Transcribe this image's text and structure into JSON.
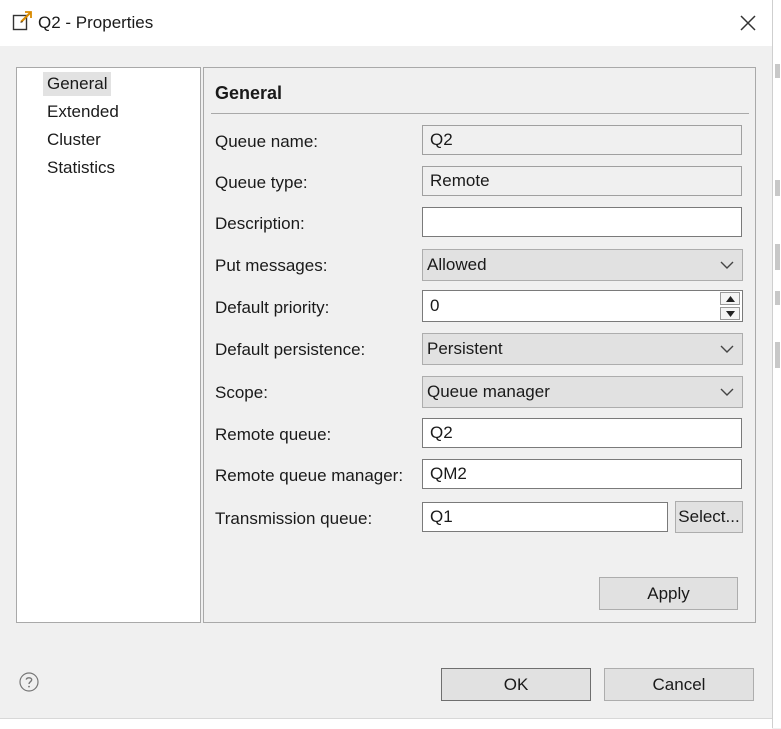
{
  "window": {
    "title": "Q2 - Properties"
  },
  "nav": {
    "items": [
      {
        "label": "General",
        "selected": true
      },
      {
        "label": "Extended",
        "selected": false
      },
      {
        "label": "Cluster",
        "selected": false
      },
      {
        "label": "Statistics",
        "selected": false
      }
    ]
  },
  "panel": {
    "heading": "General",
    "queue_name": {
      "label": "Queue name:",
      "value": "Q2"
    },
    "queue_type": {
      "label": "Queue type:",
      "value": "Remote"
    },
    "description": {
      "label": "Description:",
      "value": ""
    },
    "put_messages": {
      "label": "Put messages:",
      "value": "Allowed"
    },
    "default_priority": {
      "label": "Default priority:",
      "value": "0"
    },
    "default_persistence": {
      "label": "Default persistence:",
      "value": "Persistent"
    },
    "scope": {
      "label": "Scope:",
      "value": "Queue manager"
    },
    "remote_queue": {
      "label": "Remote queue:",
      "value": "Q2"
    },
    "remote_queue_manager": {
      "label": "Remote queue manager:",
      "value": "QM2"
    },
    "transmission_queue": {
      "label": "Transmission queue:",
      "value": "Q1"
    },
    "select_label": "Select...",
    "apply_label": "Apply"
  },
  "footer": {
    "ok_label": "OK",
    "cancel_label": "Cancel"
  },
  "icons": {
    "title": "properties-page-icon",
    "close": "close-icon",
    "help": "help-icon",
    "dropdown": "chevron-down-icon"
  },
  "colors": {
    "background": "#f0f0f0",
    "selection": "#e2e2e2",
    "button": "#e1e1e1"
  }
}
